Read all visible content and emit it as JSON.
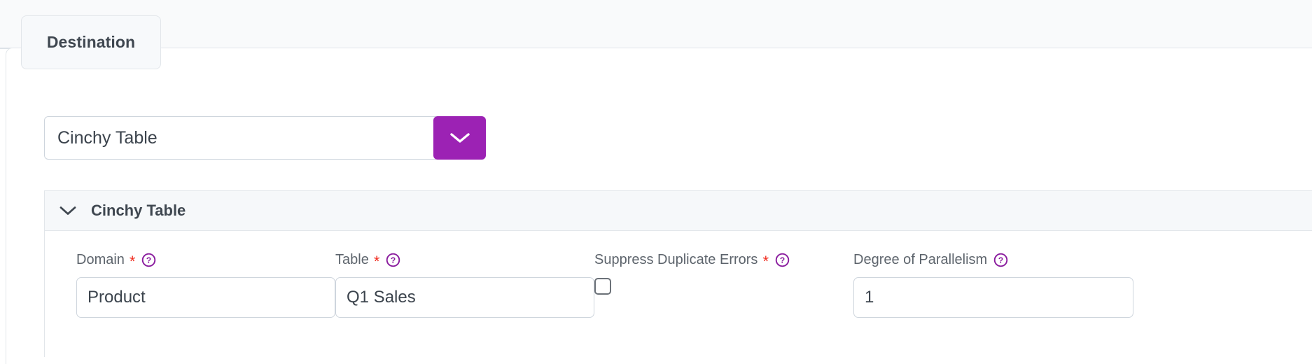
{
  "tab": {
    "label": "Destination"
  },
  "destination_select": {
    "value": "Cinchy Table",
    "toggle_icon": "chevron-down-icon"
  },
  "accordion": {
    "title": "Cinchy Table",
    "expanded": true,
    "toggle_icon": "chevron-down-icon"
  },
  "fields": {
    "domain": {
      "label": "Domain",
      "required_marker": "*",
      "help_icon": "help-circle-icon",
      "value": "Product"
    },
    "table": {
      "label": "Table",
      "required_marker": "*",
      "help_icon": "help-circle-icon",
      "value": "Q1 Sales"
    },
    "suppress_duplicate_errors": {
      "label": "Suppress Duplicate Errors",
      "required_marker": "*",
      "help_icon": "help-circle-icon",
      "checked": false
    },
    "degree_of_parallelism": {
      "label": "Degree of Parallelism",
      "required_marker": "",
      "help_icon": "help-circle-icon",
      "value": "1"
    }
  },
  "colors": {
    "accent_purple": "#9c22b4",
    "required_red": "#f02a1d",
    "border_gray": "#e2e6ea",
    "input_border": "#ced5dd",
    "header_bg": "#f6f8fa",
    "top_band_bg": "#f9fafb",
    "text_dark": "#3f4750",
    "label_gray": "#5d646c"
  }
}
